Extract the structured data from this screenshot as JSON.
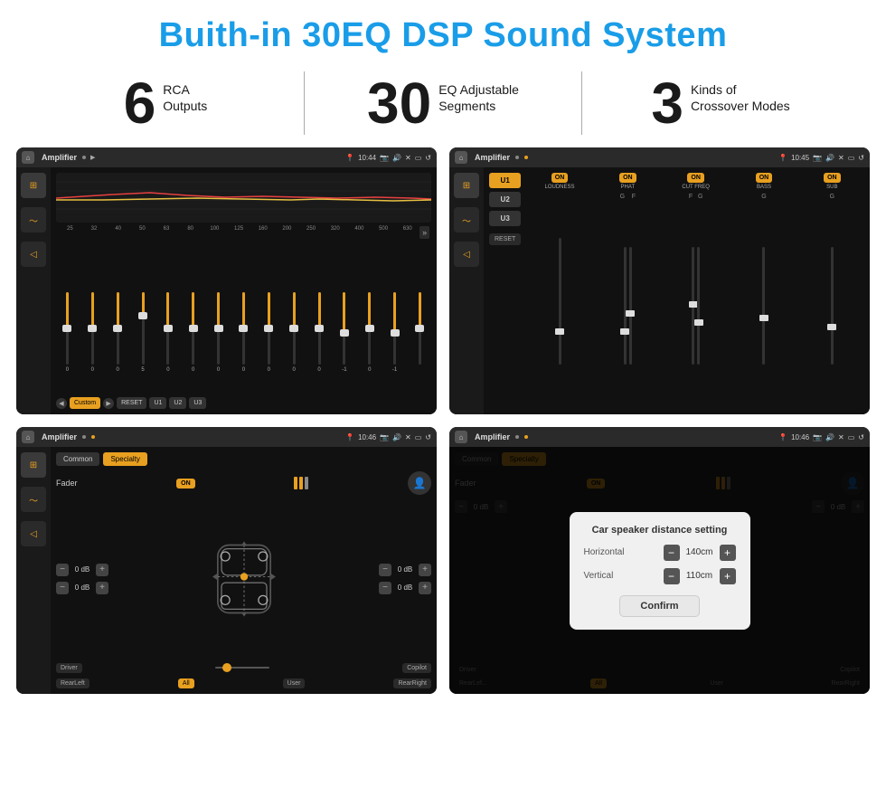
{
  "header": {
    "title": "Buith-in 30EQ DSP Sound System"
  },
  "stats": [
    {
      "number": "6",
      "line1": "RCA",
      "line2": "Outputs"
    },
    {
      "number": "30",
      "line1": "EQ Adjustable",
      "line2": "Segments"
    },
    {
      "number": "3",
      "line1": "Kinds of",
      "line2": "Crossover Modes"
    }
  ],
  "screens": [
    {
      "id": "screen1",
      "statusBar": {
        "title": "Amplifier",
        "time": "10:44"
      },
      "type": "eq"
    },
    {
      "id": "screen2",
      "statusBar": {
        "title": "Amplifier",
        "time": "10:45"
      },
      "type": "amp-channels"
    },
    {
      "id": "screen3",
      "statusBar": {
        "title": "Amplifier",
        "time": "10:46"
      },
      "type": "fader"
    },
    {
      "id": "screen4",
      "statusBar": {
        "title": "Amplifier",
        "time": "10:46"
      },
      "type": "dialog",
      "dialog": {
        "title": "Car speaker distance setting",
        "horizontal": {
          "label": "Horizontal",
          "value": "140cm"
        },
        "vertical": {
          "label": "Vertical",
          "value": "110cm"
        },
        "confirmLabel": "Confirm"
      }
    }
  ],
  "eq": {
    "frequencies": [
      "25",
      "32",
      "40",
      "50",
      "63",
      "80",
      "100",
      "125",
      "160",
      "200",
      "250",
      "320",
      "400",
      "500",
      "630"
    ],
    "values": [
      "0",
      "0",
      "0",
      "5",
      "0",
      "0",
      "0",
      "0",
      "0",
      "0",
      "0",
      "-1",
      "0",
      "-1",
      ""
    ],
    "presets": [
      "Custom",
      "RESET",
      "U1",
      "U2",
      "U3"
    ]
  },
  "channels": {
    "presets": [
      "U1",
      "U2",
      "U3"
    ],
    "channels": [
      "LOUDNESS",
      "PHAT",
      "CUT FREQ",
      "BASS",
      "SUB"
    ]
  },
  "fader": {
    "tabs": [
      "Common",
      "Specialty"
    ],
    "label": "Fader",
    "dbValues": [
      "0 dB",
      "0 dB",
      "0 dB",
      "0 dB"
    ],
    "bottomLabels": [
      "Driver",
      "",
      "Copilot",
      "RearLeft",
      "All",
      "User",
      "RearRight"
    ]
  }
}
